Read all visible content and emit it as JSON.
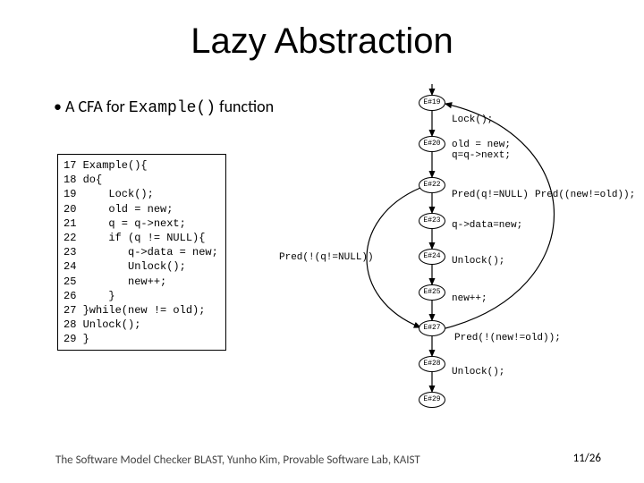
{
  "title": "Lazy Abstraction",
  "bullet_prefix": "•  A CFA for ",
  "bullet_code": "Example()",
  "bullet_suffix": " function",
  "code": "17 Example(){\n18 do{\n19     Lock();\n20     old = new;\n21     q = q->next;\n22     if (q != NULL){\n23        q->data = new;\n24        Unlock();\n25        new++;\n26     }\n27 }while(new != old);\n28 Unlock();\n29 }",
  "nodes": {
    "n19": "E#19",
    "n20": "E#20",
    "n22": "E#22",
    "n23": "E#23",
    "n24": "E#24",
    "n25": "E#25",
    "n27": "E#27",
    "n28": "E#28",
    "n29": "E#29"
  },
  "edges": {
    "lock": "Lock();",
    "old_new": "old = new;\nq=q->next;",
    "pred_q_null": "Pred(q!=NULL)",
    "pred_not_q_null": "Pred(!(q!=NULL))",
    "qdata": "q->data=new;",
    "unlock1": "Unlock();",
    "newpp": "new++;",
    "pred_new_old": "Pred((new!=old));",
    "pred_not_new_old": "Pred(!(new!=old));",
    "unlock2": "Unlock();"
  },
  "footer": "The Software Model Checker BLAST, Yunho Kim, Provable Software Lab, KAIST",
  "pagenum": "11/26"
}
